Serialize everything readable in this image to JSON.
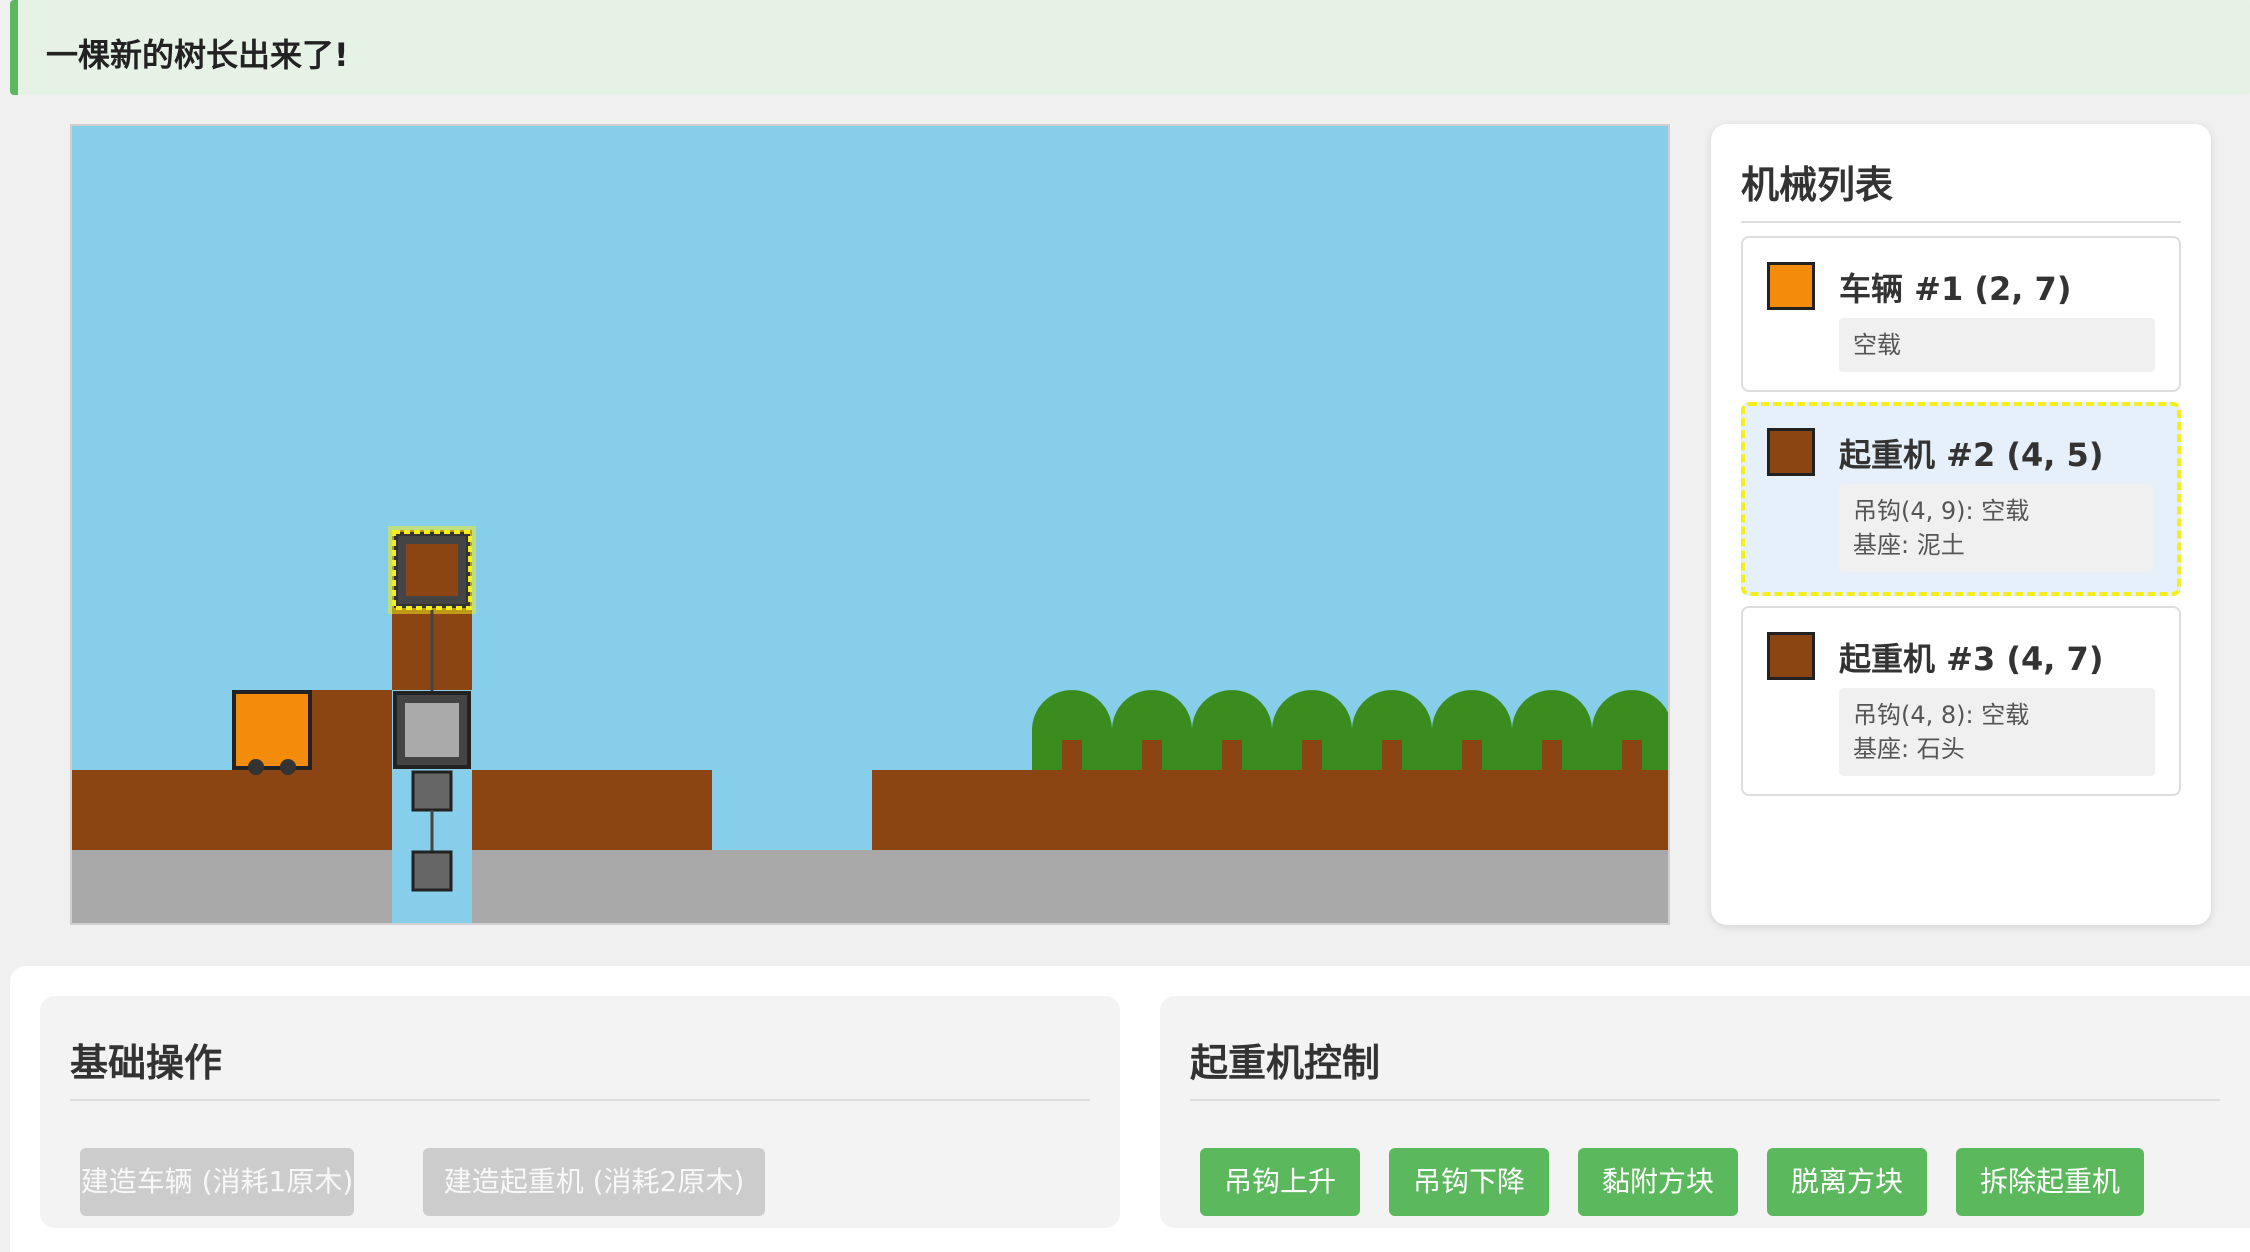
{
  "notice": {
    "message": "一棵新的树长出来了!"
  },
  "scene": {
    "colors": {
      "sky": "#87ceeb",
      "dirt": "#8b4513",
      "stone": "#a9a9a9",
      "tree": "#3a8c1e",
      "vehicle": "#f28c0a",
      "crane_body": "#aaaaaa",
      "hook": "#666666",
      "highlight": "#f4ef1a"
    }
  },
  "machines": {
    "title": "机械列表",
    "items": [
      {
        "title": "车辆 #1 (2, 7)",
        "color": "#f28c0a",
        "lines": [
          "空载"
        ],
        "selected": false
      },
      {
        "title": "起重机 #2 (4, 5)",
        "color": "#8b4513",
        "lines": [
          "吊钩(4, 9): 空载",
          "基座: 泥土"
        ],
        "selected": true
      },
      {
        "title": "起重机 #3 (4, 7)",
        "color": "#8b4513",
        "lines": [
          "吊钩(4, 8): 空载",
          "基座: 石头"
        ],
        "selected": false
      }
    ]
  },
  "basic_ops": {
    "title": "基础操作",
    "build_vehicle": "建造车辆 (消耗1原木)",
    "build_crane": "建造起重机 (消耗2原木)"
  },
  "crane_ctrl": {
    "title": "起重机控制",
    "hook_up": "吊钩上升",
    "hook_down": "吊钩下降",
    "attach": "黏附方块",
    "detach": "脱离方块",
    "remove": "拆除起重机"
  }
}
